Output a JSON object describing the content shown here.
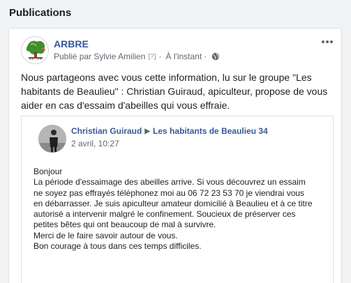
{
  "section": {
    "title": "Publications"
  },
  "post": {
    "page_name": "ARBRE",
    "published_by": "Publié par Sylvie Amilien",
    "question_mark": "[?]",
    "separator": "·",
    "time": "À l'instant",
    "visibility_icon": "globe-icon",
    "more_icon": "more-options-icon",
    "text": "Nous partageons avec vous cette information, lu sur le groupe \"Les habitants de Beaulieu\" : Christian Guiraud, apiculteur, propose de vous aider en cas d'essaim d'abeilles qui vous effraie."
  },
  "shared_post": {
    "author": "Christian Guiraud",
    "arrow": "▶",
    "group": "Les habitants de Beaulieu 34",
    "date": "2 avril, 10:27",
    "lines": [
      "Bonjour",
      "La période d'essaimage des abeilles arrive. Si vous découvrez un essaim",
      "ne soyez pas effrayés téléphonez moi au 06 72 23 53 70 je viendrai vous",
      "en débarrasser. Je suis apiculteur amateur domicilié à Beaulieu et à ce titre",
      "autorisé a intervenir malgré le confinement. Soucieux de préserver ces",
      "petites bêtes qui ont beaucoup de mal à survivre.",
      "Merci de le faire savoir autour de vous.",
      "Bon courage à tous dans ces temps difficiles."
    ]
  },
  "colors": {
    "link": "#385898",
    "meta": "#606770",
    "background": "#f2f3f5"
  }
}
